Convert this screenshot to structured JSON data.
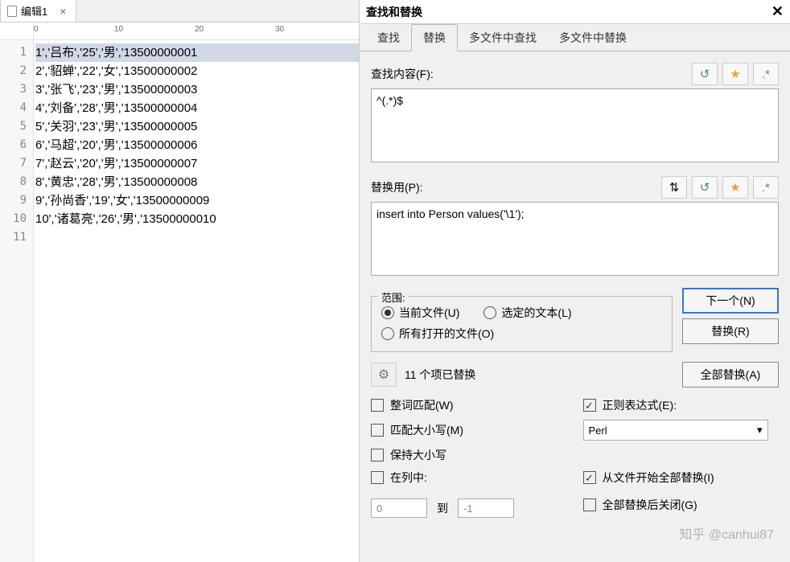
{
  "tab": {
    "title": "编辑1"
  },
  "ruler": {
    "marks": [
      "0",
      "10",
      "20",
      "30"
    ]
  },
  "lines": [
    "1','吕布','25','男','13500000001",
    "2','貂蝉','22','女','13500000002",
    "3','张飞','23','男','13500000003",
    "4','刘备','28','男','13500000004",
    "5','关羽','23','男','13500000005",
    "6','马超','20','男','13500000006",
    "7','赵云','20','男','13500000007",
    "8','黄忠','28','男','13500000008",
    "9','孙尚香','19','女','13500000009",
    "10','诸葛亮','26','男','13500000010"
  ],
  "dlg": {
    "title": "查找和替换",
    "tabs": {
      "find": "查找",
      "replace": "替换",
      "multifind": "多文件中查找",
      "multireplace": "多文件中替换"
    },
    "find_label": "查找内容(F):",
    "find_value": "^(.*)$",
    "replace_label": "替换用(P):",
    "replace_value": "insert into Person values('\\1');",
    "scope": {
      "legend": "范围:",
      "current": "当前文件(U)",
      "selection": "选定的文本(L)",
      "allopen": "所有打开的文件(O)"
    },
    "buttons": {
      "next": "下一个(N)",
      "replace": "替换(R)",
      "replace_all": "全部替换(A)"
    },
    "status": "11 个项已替换",
    "checks": {
      "whole": "整词匹配(W)",
      "regex": "正则表达式(E):",
      "case": "匹配大小写(M)",
      "preserve": "保持大小写",
      "incol": "在列中:",
      "fromstart": "从文件开始全部替换(I)",
      "closeafter": "全部替换后关闭(G)"
    },
    "regex_mode": "Perl",
    "col_from": "0",
    "col_to_label": "到",
    "col_to": "-1"
  },
  "watermark": "知乎 @canhui87"
}
